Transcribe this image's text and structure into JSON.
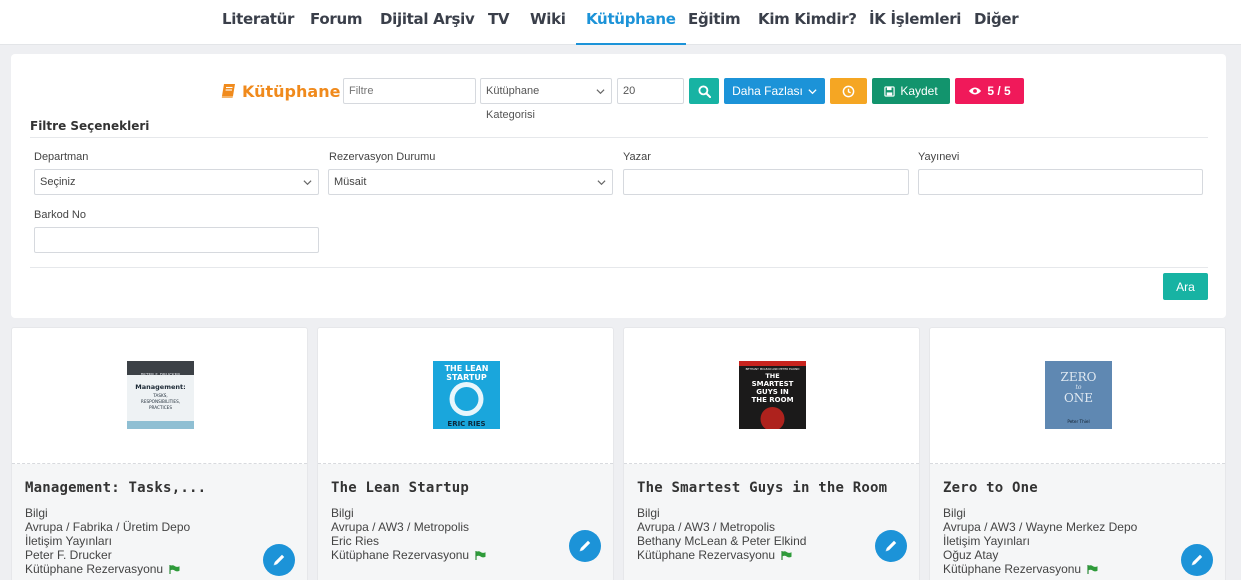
{
  "nav": {
    "items": [
      "Literatür",
      "Forum",
      "Dijital Arşiv",
      "TV",
      "Wiki",
      "Kütüphane",
      "Eğitim",
      "Kim Kimdir?",
      "İK İşlemleri",
      "Diğer"
    ],
    "active": "Kütüphane"
  },
  "toolbar": {
    "title": "Kütüphane",
    "filter_placeholder": "Filtre",
    "category_value": "Kütüphane Kategorisi",
    "page_size": "20",
    "more_label": "Daha Fazlası",
    "save_label": "Kaydet",
    "view_count": "5 / 5"
  },
  "filters": {
    "section_title": "Filtre Seçenekleri",
    "department_label": "Departman",
    "department_value": "Seçiniz",
    "reservation_label": "Rezervasyon Durumu",
    "reservation_value": "Müsait",
    "author_label": "Yazar",
    "author_value": "",
    "publisher_label": "Yayınevi",
    "publisher_value": "",
    "barcode_label": "Barkod No",
    "barcode_value": "",
    "search_label": "Ara"
  },
  "books": [
    {
      "title": "Management: Tasks,...",
      "category": "Bilgi",
      "location": "Avrupa / Fabrika / Üretim Depo",
      "publisher": "İletişim Yayınları",
      "author": "Peter F. Drucker",
      "status": "Kütüphane Rezervasyonu",
      "cover_text": [
        "PETER F. DRUCKER",
        "Management:",
        "TASKS,",
        "RESPONSIBILITIES,",
        "PRACTICES"
      ]
    },
    {
      "title": "The Lean Startup",
      "category": "Bilgi",
      "location": "Avrupa / AW3 / Metropolis",
      "publisher": "Eric Ries",
      "author": "",
      "status": "Kütüphane Rezervasyonu",
      "cover_text": [
        "THE LEAN",
        "STARTUP",
        "ERIC RIES"
      ]
    },
    {
      "title": "The Smartest Guys in the Room",
      "category": "Bilgi",
      "location": "Avrupa / AW3 / Metropolis",
      "publisher": "Bethany McLean & Peter Elkind",
      "author": "",
      "status": "Kütüphane Rezervasyonu",
      "cover_text": [
        "BETHANY MCLEAN AND PETER ELKIND",
        "THE",
        "SMARTEST",
        "GUYS IN",
        "THE ROOM"
      ]
    },
    {
      "title": "Zero to One",
      "category": "Bilgi",
      "location": "Avrupa / AW3 / Wayne Merkez Depo",
      "publisher": "İletişim Yayınları",
      "author": "Oğuz Atay",
      "status": "Kütüphane Rezervasyonu",
      "cover_text": [
        "ZERO",
        "to",
        "ONE",
        "Peter Thiel"
      ]
    }
  ],
  "colors": {
    "accent": "#1c93d8",
    "brand": "#f08a1c",
    "teal": "#17b3a3",
    "save": "#12946d",
    "warning": "#f5a623",
    "views": "#f0195a"
  },
  "icons": {
    "search": "search-icon",
    "clock": "clock-icon",
    "save": "floppy-icon",
    "eye": "eye-icon",
    "edit": "pencil-icon",
    "flag": "flag-icon",
    "book": "book-icon"
  }
}
